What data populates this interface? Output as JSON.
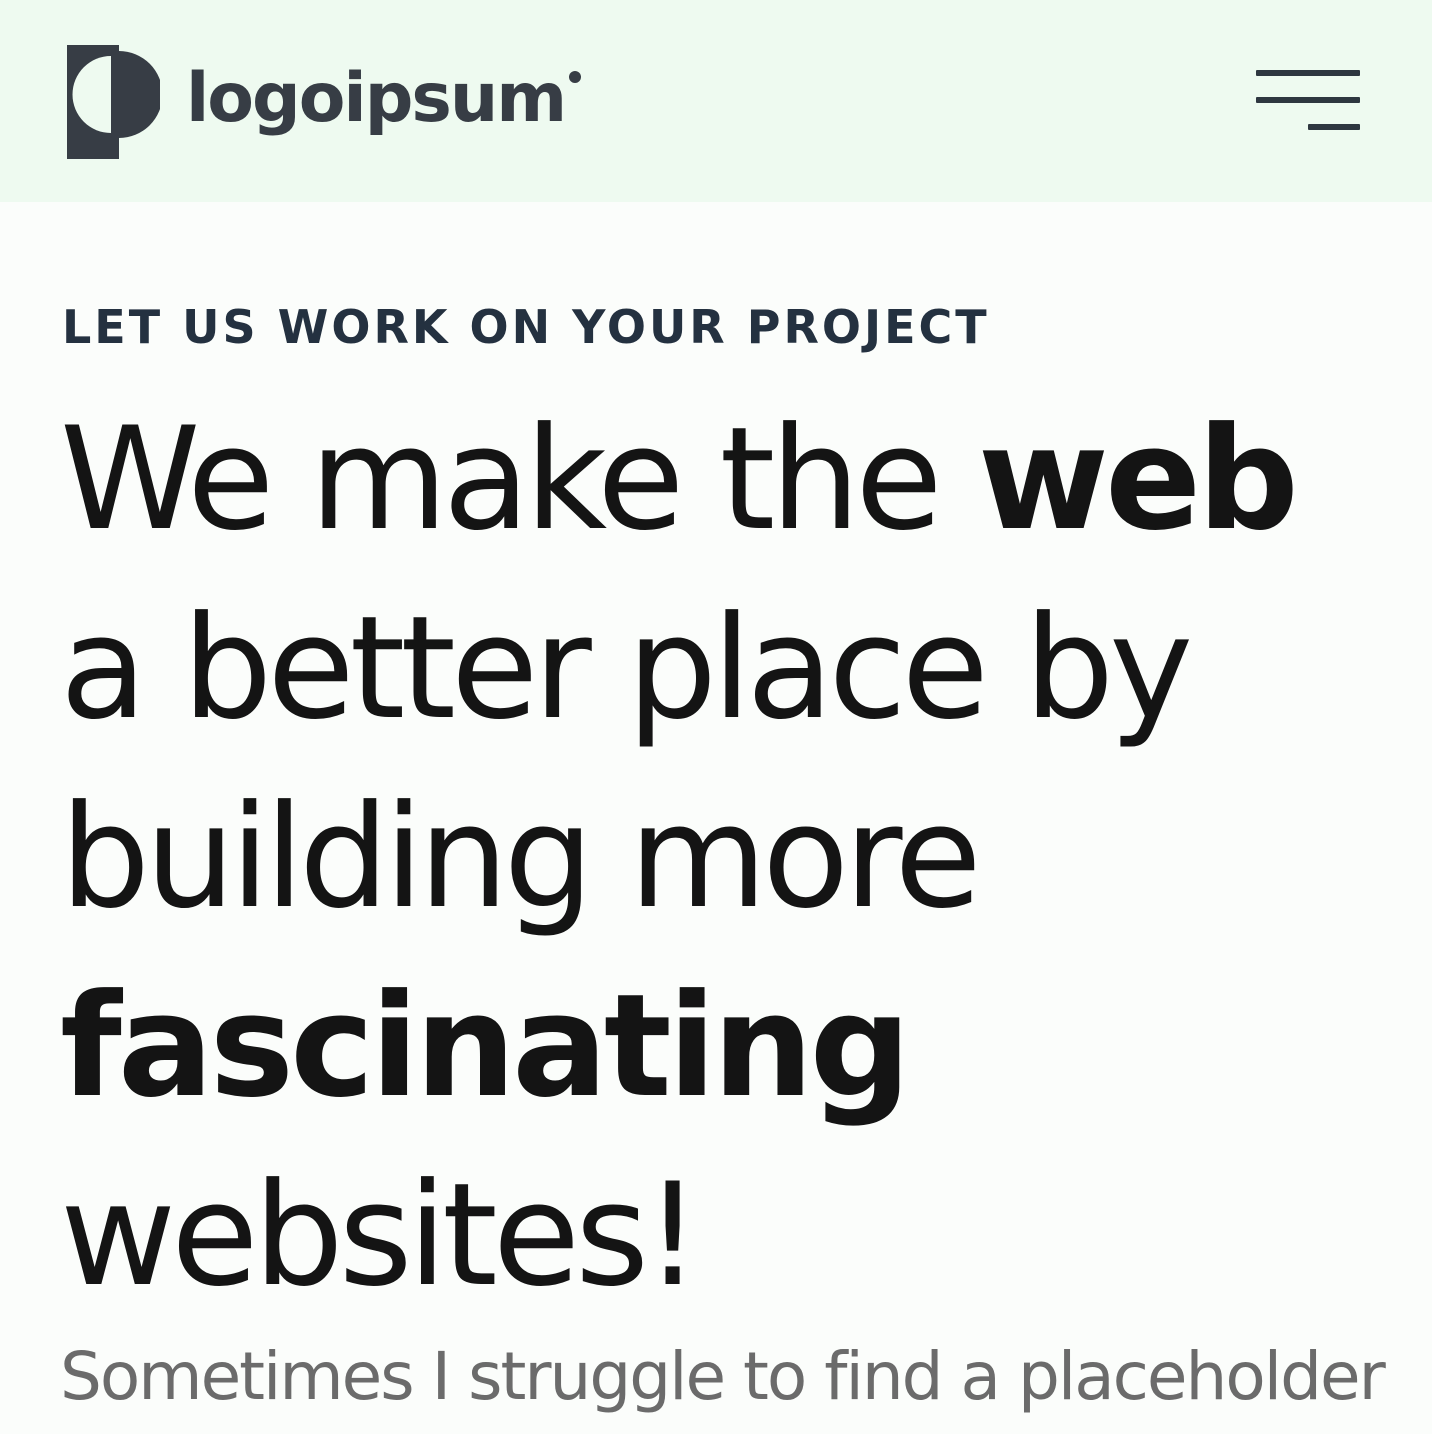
{
  "header": {
    "logo_text": "logoipsum",
    "logo_icon": "logoipsum-mark-icon",
    "menu_icon": "hamburger-menu-icon",
    "background": "#eefaf0"
  },
  "hero": {
    "eyebrow": "LET US WORK ON YOUR PROJECT",
    "headline": {
      "line1_light": "We make the ",
      "line1_bold": "web",
      "line2": "a better place by",
      "line3": "building more",
      "line4_bold": "fascinating",
      "line5": "websites!"
    },
    "subtext": "Sometimes I struggle to find a placeholder"
  },
  "colors": {
    "text_dark": "#141414",
    "eyebrow": "#243140",
    "subtext": "#6b6b6b",
    "logo": "#373d45"
  }
}
